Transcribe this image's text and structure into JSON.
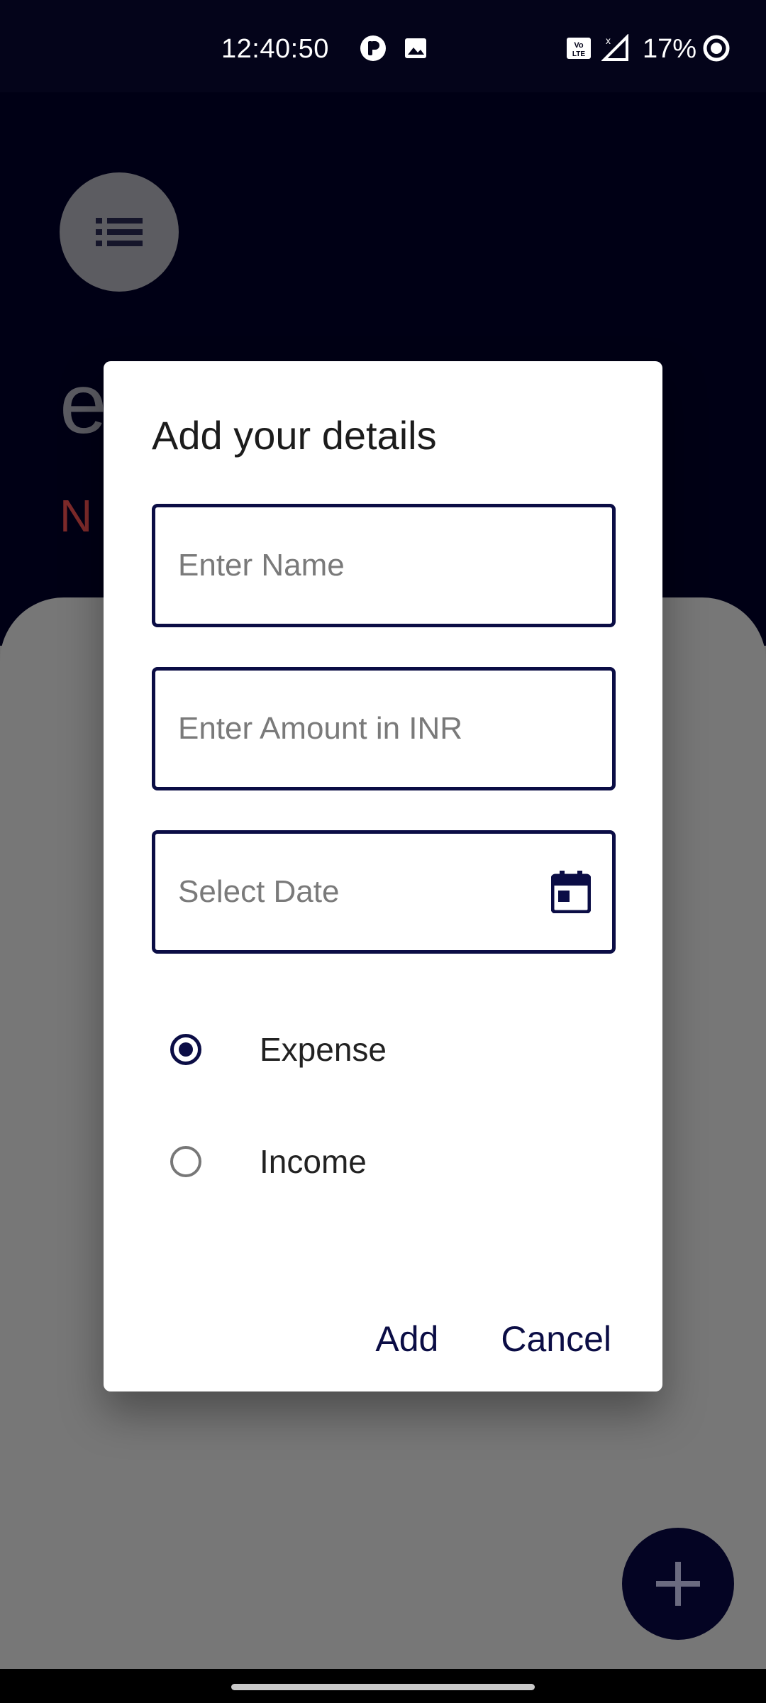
{
  "status_bar": {
    "time": "12:40:50",
    "battery": "17%",
    "icons": [
      "pip-icon",
      "gallery-icon",
      "volte-icon",
      "signal-icon",
      "battery-icon"
    ]
  },
  "background_app": {
    "title_partial": "e",
    "subtitle_partial": "N",
    "accent_color": "#000015"
  },
  "dialog": {
    "title": "Add your details",
    "fields": {
      "name_placeholder": "Enter Name",
      "amount_placeholder": "Enter Amount in INR",
      "date_placeholder": "Select Date"
    },
    "radios": [
      {
        "label": "Expense",
        "selected": true
      },
      {
        "label": "Income",
        "selected": false
      }
    ],
    "actions": {
      "add_label": "Add",
      "cancel_label": "Cancel"
    }
  },
  "colors": {
    "primary": "#0b0d45",
    "scrim": "#727272"
  }
}
